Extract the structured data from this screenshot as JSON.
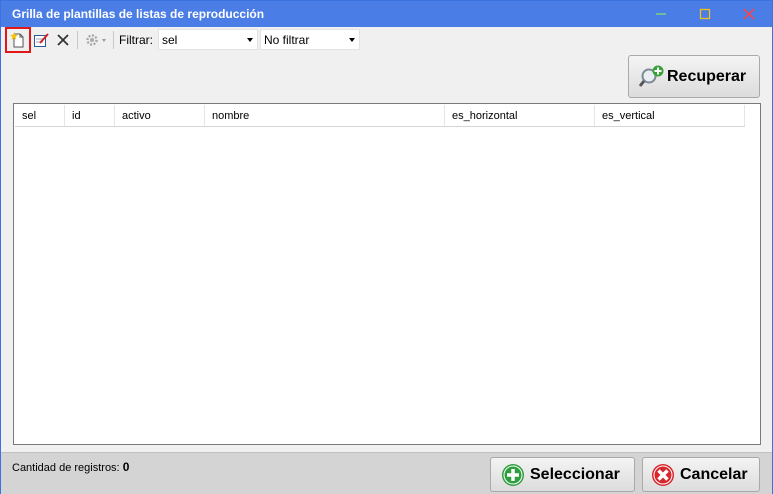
{
  "window": {
    "title": "Grilla de plantillas de listas de reproducción",
    "accent": "#4a7de6"
  },
  "toolbar": {
    "filter_label": "Filtrar:",
    "filter_field": "sel",
    "filter_mode": "No filtrar"
  },
  "actions": {
    "recuperar_label": "Recuperar",
    "seleccionar_label": "Seleccionar",
    "cancelar_label": "Cancelar"
  },
  "grid": {
    "columns": [
      "sel",
      "id",
      "activo",
      "nombre",
      "es_horizontal",
      "es_vertical"
    ],
    "rows": []
  },
  "footer": {
    "count_label": "Cantidad de registros:",
    "count_value": "0"
  },
  "icons": {
    "new": "new-document-icon",
    "edit": "edit-icon",
    "delete": "delete-icon",
    "settings": "gear-icon",
    "recuperar": "search-add-icon",
    "seleccionar": "plus-circle-icon",
    "cancelar": "close-circle-icon"
  }
}
